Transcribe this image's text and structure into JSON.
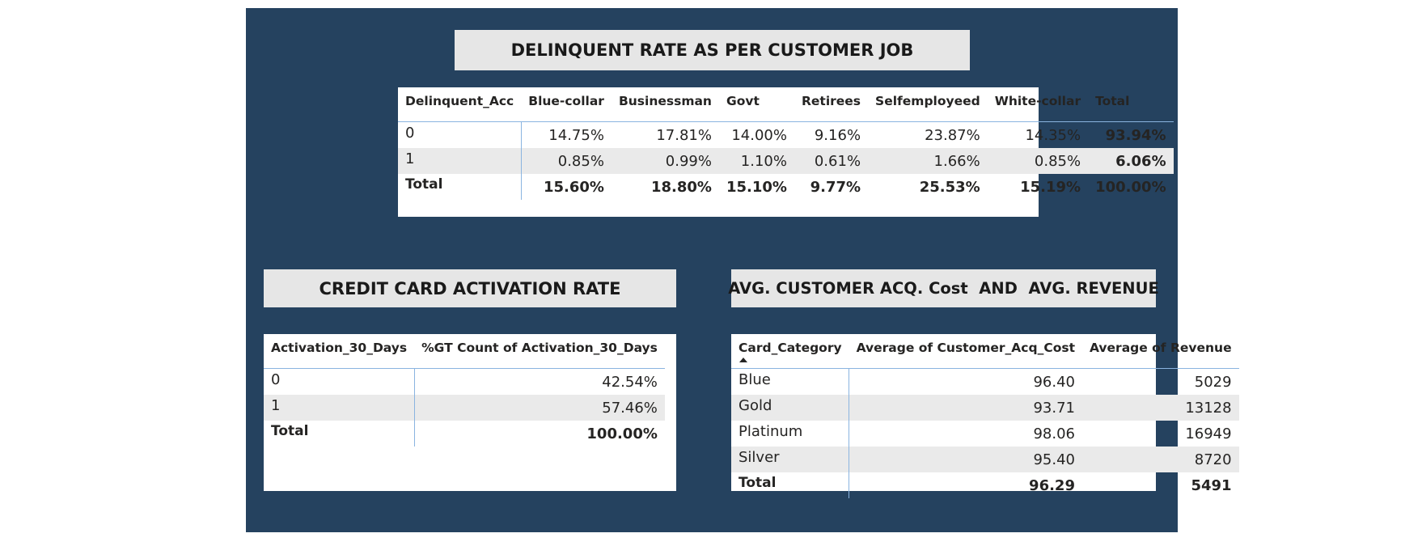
{
  "delinquent": {
    "title": "DELINQUENT RATE AS PER CUSTOMER JOB",
    "columns": [
      "Delinquent_Acc",
      "Blue-collar",
      "Businessman",
      "Govt",
      "Retirees",
      "Selfemployeed",
      "White-collar",
      "Total"
    ],
    "rows": [
      {
        "label": "0",
        "values": [
          "14.75%",
          "17.81%",
          "14.00%",
          "9.16%",
          "23.87%",
          "14.35%"
        ],
        "total": "93.94%"
      },
      {
        "label": "1",
        "values": [
          "0.85%",
          "0.99%",
          "1.10%",
          "0.61%",
          "1.66%",
          "0.85%"
        ],
        "total": "6.06%"
      },
      {
        "label": "Total",
        "values": [
          "15.60%",
          "18.80%",
          "15.10%",
          "9.77%",
          "25.53%",
          "15.19%"
        ],
        "total": "100.00%"
      }
    ]
  },
  "activation": {
    "title": "CREDIT CARD ACTIVATION RATE",
    "columns": [
      "Activation_30_Days",
      "%GT Count of Activation_30_Days"
    ],
    "rows": [
      {
        "label": "0",
        "value": "42.54%"
      },
      {
        "label": "1",
        "value": "57.46%"
      },
      {
        "label": "Total",
        "value": "100.00%"
      }
    ]
  },
  "acquisition": {
    "title": "AVG. CUSTOMER ACQ. Cost  AND  AVG. REVENUE",
    "columns": [
      "Card_Category",
      "Average of Customer_Acq_Cost",
      "Average of Revenue"
    ],
    "sort_icon": "sort-ascending-icon",
    "rows": [
      {
        "label": "Blue",
        "cost": "96.40",
        "revenue": "5029"
      },
      {
        "label": "Gold",
        "cost": "93.71",
        "revenue": "13128"
      },
      {
        "label": "Platinum",
        "cost": "98.06",
        "revenue": "16949"
      },
      {
        "label": "Silver",
        "cost": "95.40",
        "revenue": "8720"
      },
      {
        "label": "Total",
        "cost": "96.29",
        "revenue": "5491"
      }
    ]
  },
  "colors": {
    "canvas_bg": "#25425f",
    "title_bg": "#e6e6e6",
    "row_alt_bg": "#eaeaea",
    "separator": "#8ab4e0"
  }
}
